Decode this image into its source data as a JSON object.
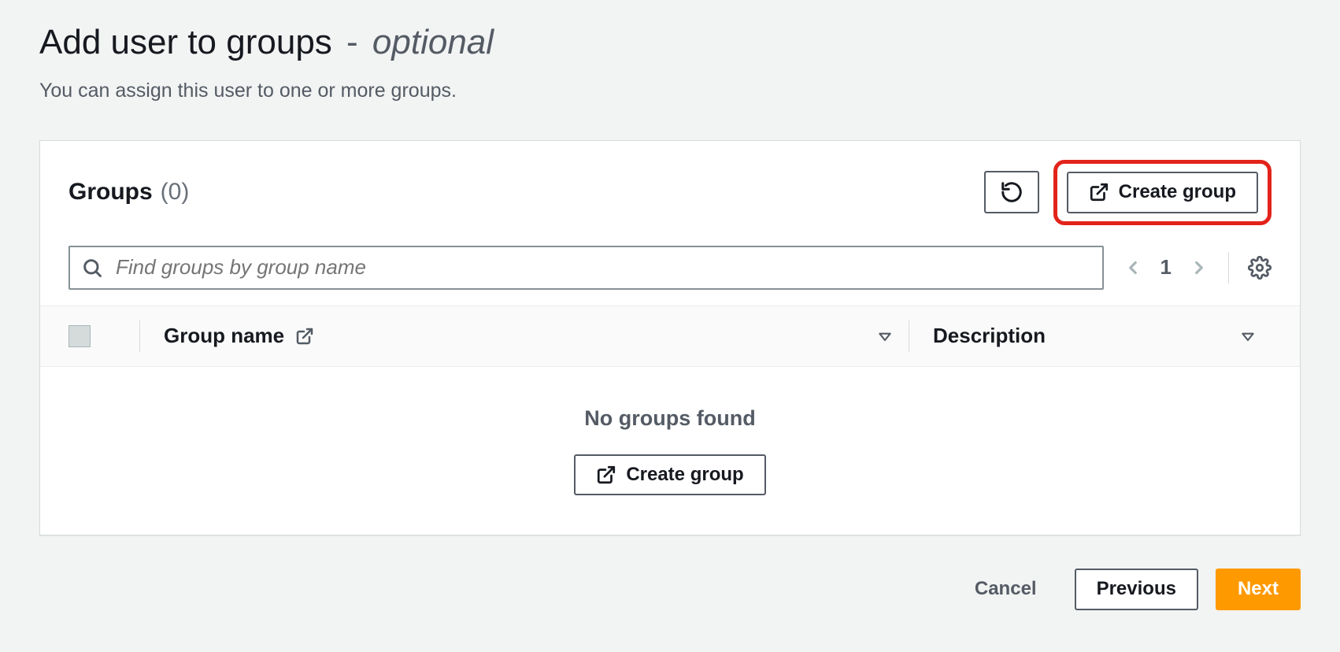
{
  "heading": {
    "main": "Add user to groups",
    "separator": " - ",
    "optional": "optional"
  },
  "subtitle": "You can assign this user to one or more groups.",
  "groups_panel": {
    "title": "Groups",
    "count_text": "(0)",
    "create_group_label": "Create group",
    "search_placeholder": "Find groups by group name",
    "page_number": "1",
    "columns": {
      "group_name": "Group name",
      "description": "Description"
    },
    "empty": {
      "message": "No groups found",
      "create_group_label": "Create group"
    }
  },
  "footer": {
    "cancel": "Cancel",
    "previous": "Previous",
    "next": "Next"
  }
}
